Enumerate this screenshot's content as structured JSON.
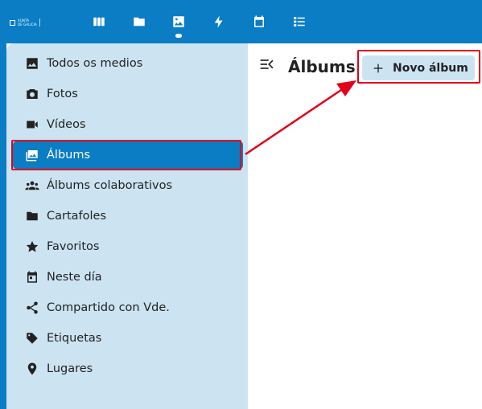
{
  "header": {
    "logo_text_1": "XUNTA",
    "logo_text_2": "DE GALICIA",
    "apps": [
      {
        "icon": "dashboard-icon"
      },
      {
        "icon": "folder-icon"
      },
      {
        "icon": "photos-icon",
        "active": true
      },
      {
        "icon": "activity-icon"
      },
      {
        "icon": "calendar-icon"
      },
      {
        "icon": "tasks-icon"
      }
    ]
  },
  "sidebar": {
    "items": [
      {
        "label": "Todos os medios",
        "icon": "image-icon"
      },
      {
        "label": "Fotos",
        "icon": "camera-icon"
      },
      {
        "label": "Vídeos",
        "icon": "video-icon"
      },
      {
        "label": "Álbums",
        "icon": "albums-icon",
        "active": true
      },
      {
        "label": "Álbums colaborativos",
        "icon": "people-icon"
      },
      {
        "label": "Cartafoles",
        "icon": "folder-icon"
      },
      {
        "label": "Favoritos",
        "icon": "star-icon"
      },
      {
        "label": "Neste día",
        "icon": "calendar-icon"
      },
      {
        "label": "Compartido con Vde.",
        "icon": "share-icon"
      },
      {
        "label": "Etiquetas",
        "icon": "tag-icon"
      },
      {
        "label": "Lugares",
        "icon": "map-marker-icon"
      }
    ]
  },
  "main": {
    "title": "Álbums",
    "new_album_label": "Novo álbum"
  },
  "colors": {
    "brand": "#0a7dc4",
    "sidebar_bg": "#cce4f2",
    "highlight": "#e3001b"
  }
}
